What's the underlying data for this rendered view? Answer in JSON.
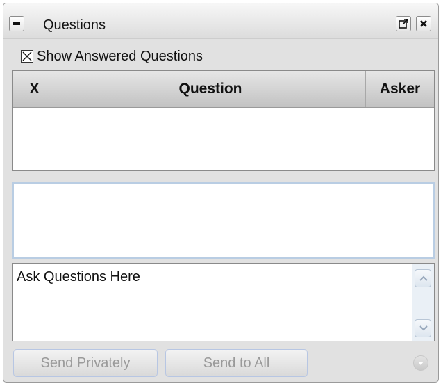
{
  "panel": {
    "title": "Questions",
    "collapse_icon": "minus-icon",
    "popout_icon": "popout-icon",
    "close_icon": "close-icon"
  },
  "show_answered": {
    "label": "Show Answered Questions",
    "checked": true
  },
  "table": {
    "columns": [
      "X",
      "Question",
      "Asker"
    ],
    "rows": []
  },
  "question_input": {
    "value": "Ask Questions Here"
  },
  "buttons": {
    "send_privately": "Send Privately",
    "send_to_all": "Send to All",
    "options_icon": "chevron-down-icon"
  }
}
